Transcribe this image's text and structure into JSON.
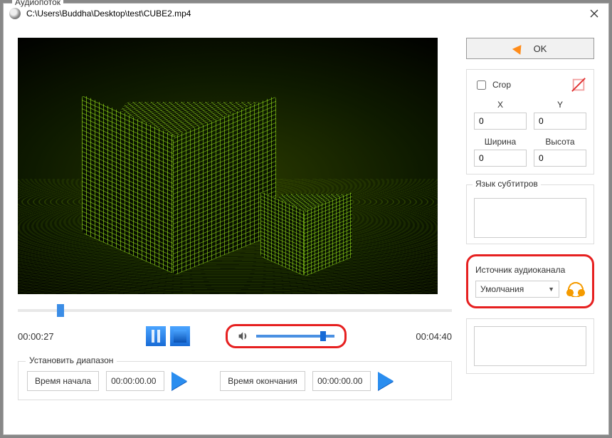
{
  "window": {
    "title": "C:\\Users\\Buddha\\Desktop\\test\\CUBE2.mp4"
  },
  "playback": {
    "current_time": "00:00:27",
    "total_time": "00:04:40",
    "seek_percent": 9,
    "volume_percent": 82
  },
  "range": {
    "legend": "Установить диапазон",
    "start_button": "Время начала",
    "start_value": "00:00:00.00",
    "end_button": "Время окончания",
    "end_value": "00:00:00.00"
  },
  "right": {
    "ok_label": "OK",
    "crop": {
      "label": "Crop",
      "checked": false,
      "x_label": "X",
      "y_label": "Y",
      "x_value": "0",
      "y_value": "0",
      "w_label": "Ширина",
      "h_label": "Высота",
      "w_value": "0",
      "h_value": "0"
    },
    "subtitles": {
      "legend": "Язык субтитров"
    },
    "audio": {
      "legend": "Аудиопоток",
      "source_label": "Источник аудиоканала",
      "selected": "Умолчания"
    }
  }
}
